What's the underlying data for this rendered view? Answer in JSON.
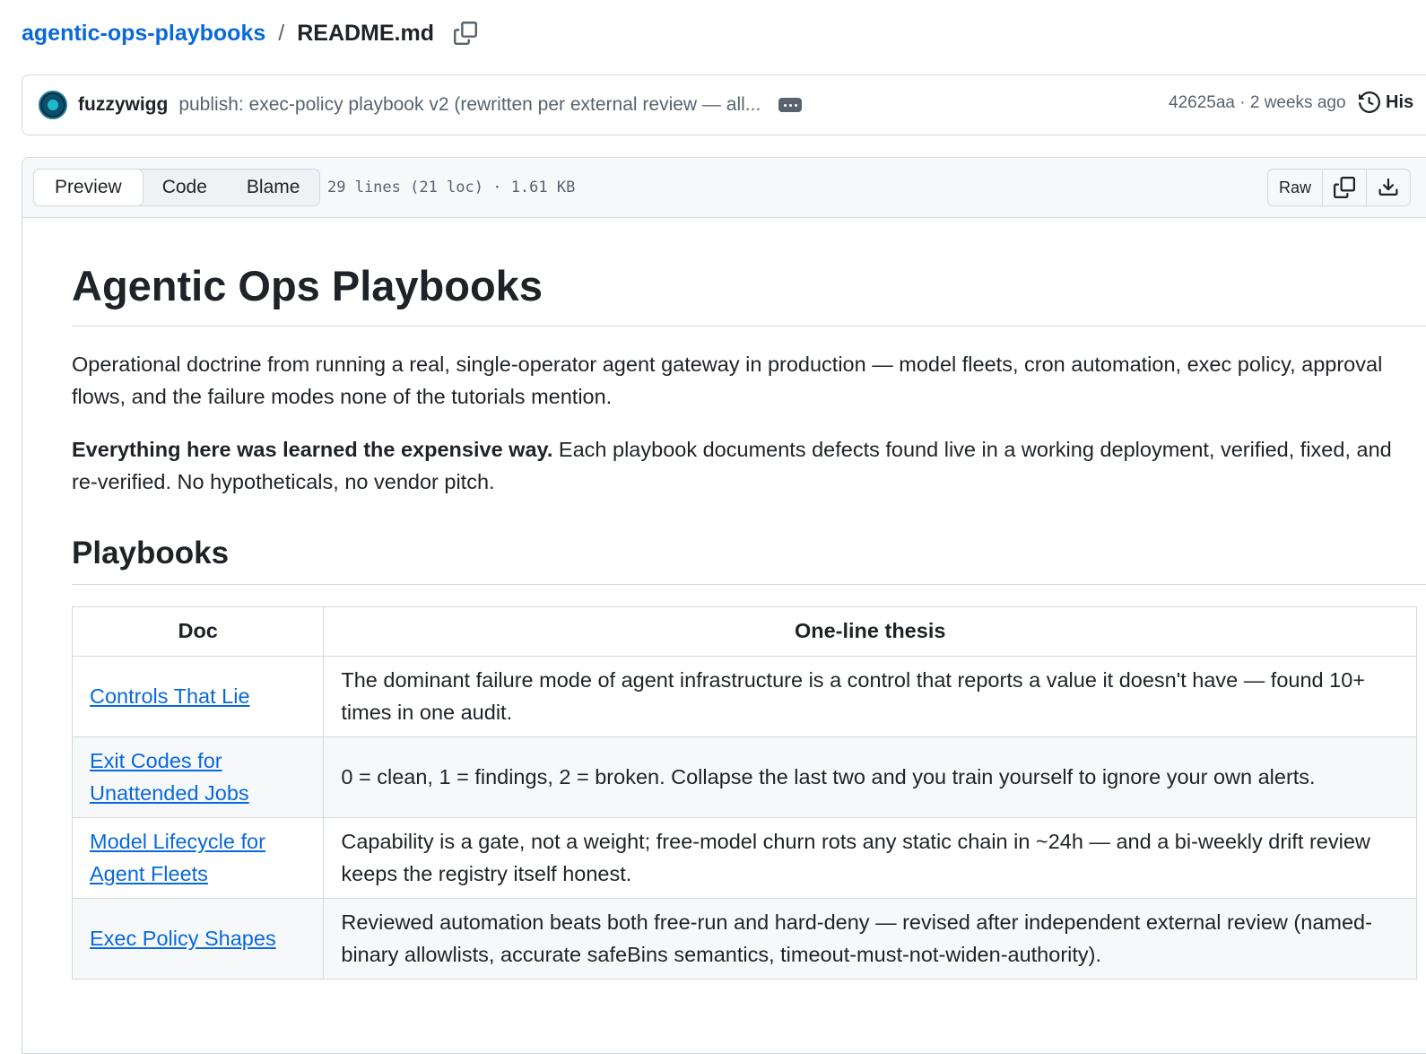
{
  "breadcrumb": {
    "repo": "agentic-ops-playbooks",
    "separator": "/",
    "file": "README.md",
    "copy_icon": "copy-icon"
  },
  "commit": {
    "author": "fuzzywigg",
    "message": "publish: exec-policy playbook v2 (rewritten per external review — all...",
    "sha_time": "42625aa · 2 weeks ago",
    "history_label": "His"
  },
  "file_header": {
    "tabs": [
      "Preview",
      "Code",
      "Blame"
    ],
    "active_tab": "Preview",
    "meta": "29 lines (21 loc) · 1.61 KB",
    "raw_label": "Raw"
  },
  "readme": {
    "title": "Agentic Ops Playbooks",
    "intro": "Operational doctrine from running a real, single-operator agent gateway in production — model fleets, cron automation, exec policy, approval flows, and the failure modes none of the tutorials mention.",
    "lead_bold": "Everything here was learned the expensive way.",
    "lead_rest": " Each playbook documents defects found live in a working deployment, verified, fixed, and re-verified. No hypotheticals, no vendor pitch.",
    "section_title": "Playbooks",
    "table": {
      "headers": [
        "Doc",
        "One-line thesis"
      ],
      "rows": [
        {
          "doc": "Controls That Lie",
          "thesis": "The dominant failure mode of agent infrastructure is a control that reports a value it doesn't have — found 10+ times in one audit."
        },
        {
          "doc": "Exit Codes for Unattended Jobs",
          "thesis": "0 = clean, 1 = findings, 2 = broken. Collapse the last two and you train yourself to ignore your own alerts."
        },
        {
          "doc": "Model Lifecycle for Agent Fleets",
          "thesis": "Capability is a gate, not a weight; free-model churn rots any static chain in ~24h — and a bi-weekly drift review keeps the registry itself honest."
        },
        {
          "doc": "Exec Policy Shapes",
          "thesis": "Reviewed automation beats both free-run and hard-deny — revised after independent external review (named-binary allowlists, accurate safeBins semantics, timeout-must-not-widen-authority)."
        }
      ]
    }
  },
  "colors": {
    "link": "#0969da",
    "text": "#1f2328",
    "muted": "#59636e",
    "border": "#d1d9e0",
    "header_bg": "#f6f8fa"
  }
}
